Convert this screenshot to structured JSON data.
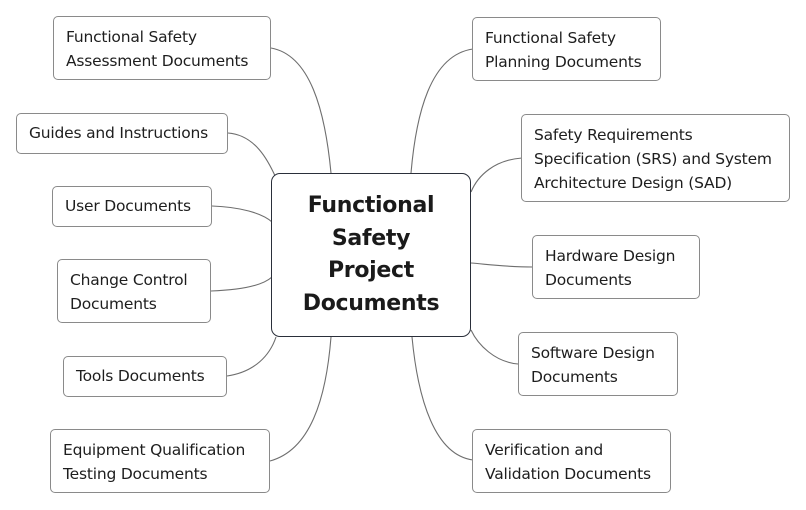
{
  "central_topic": {
    "lines": [
      "Functional",
      "Safety",
      "Project",
      "Documents"
    ]
  },
  "left_branches": [
    {
      "lines": [
        "Functional Safety",
        "Assessment Documents"
      ]
    },
    {
      "lines": [
        "Guides and Instructions"
      ]
    },
    {
      "lines": [
        "User Documents"
      ]
    },
    {
      "lines": [
        "Change Control",
        "Documents"
      ]
    },
    {
      "lines": [
        "Tools Documents"
      ]
    },
    {
      "lines": [
        "Equipment Qualification",
        "Testing Documents"
      ]
    }
  ],
  "right_branches": [
    {
      "lines": [
        "Functional Safety",
        "Planning Documents"
      ]
    },
    {
      "lines": [
        "Safety Requirements",
        "Specification (SRS) and System",
        "Architecture Design (SAD)"
      ]
    },
    {
      "lines": [
        "Hardware Design",
        "Documents"
      ]
    },
    {
      "lines": [
        "Software Design",
        "Documents"
      ]
    },
    {
      "lines": [
        "Verification and",
        "Validation Documents"
      ]
    }
  ],
  "colors": {
    "connector": "#6e6e6e",
    "node_border": "#8a8a8a",
    "center_border": "#2a2f3a",
    "text": "#1e1e1e"
  }
}
